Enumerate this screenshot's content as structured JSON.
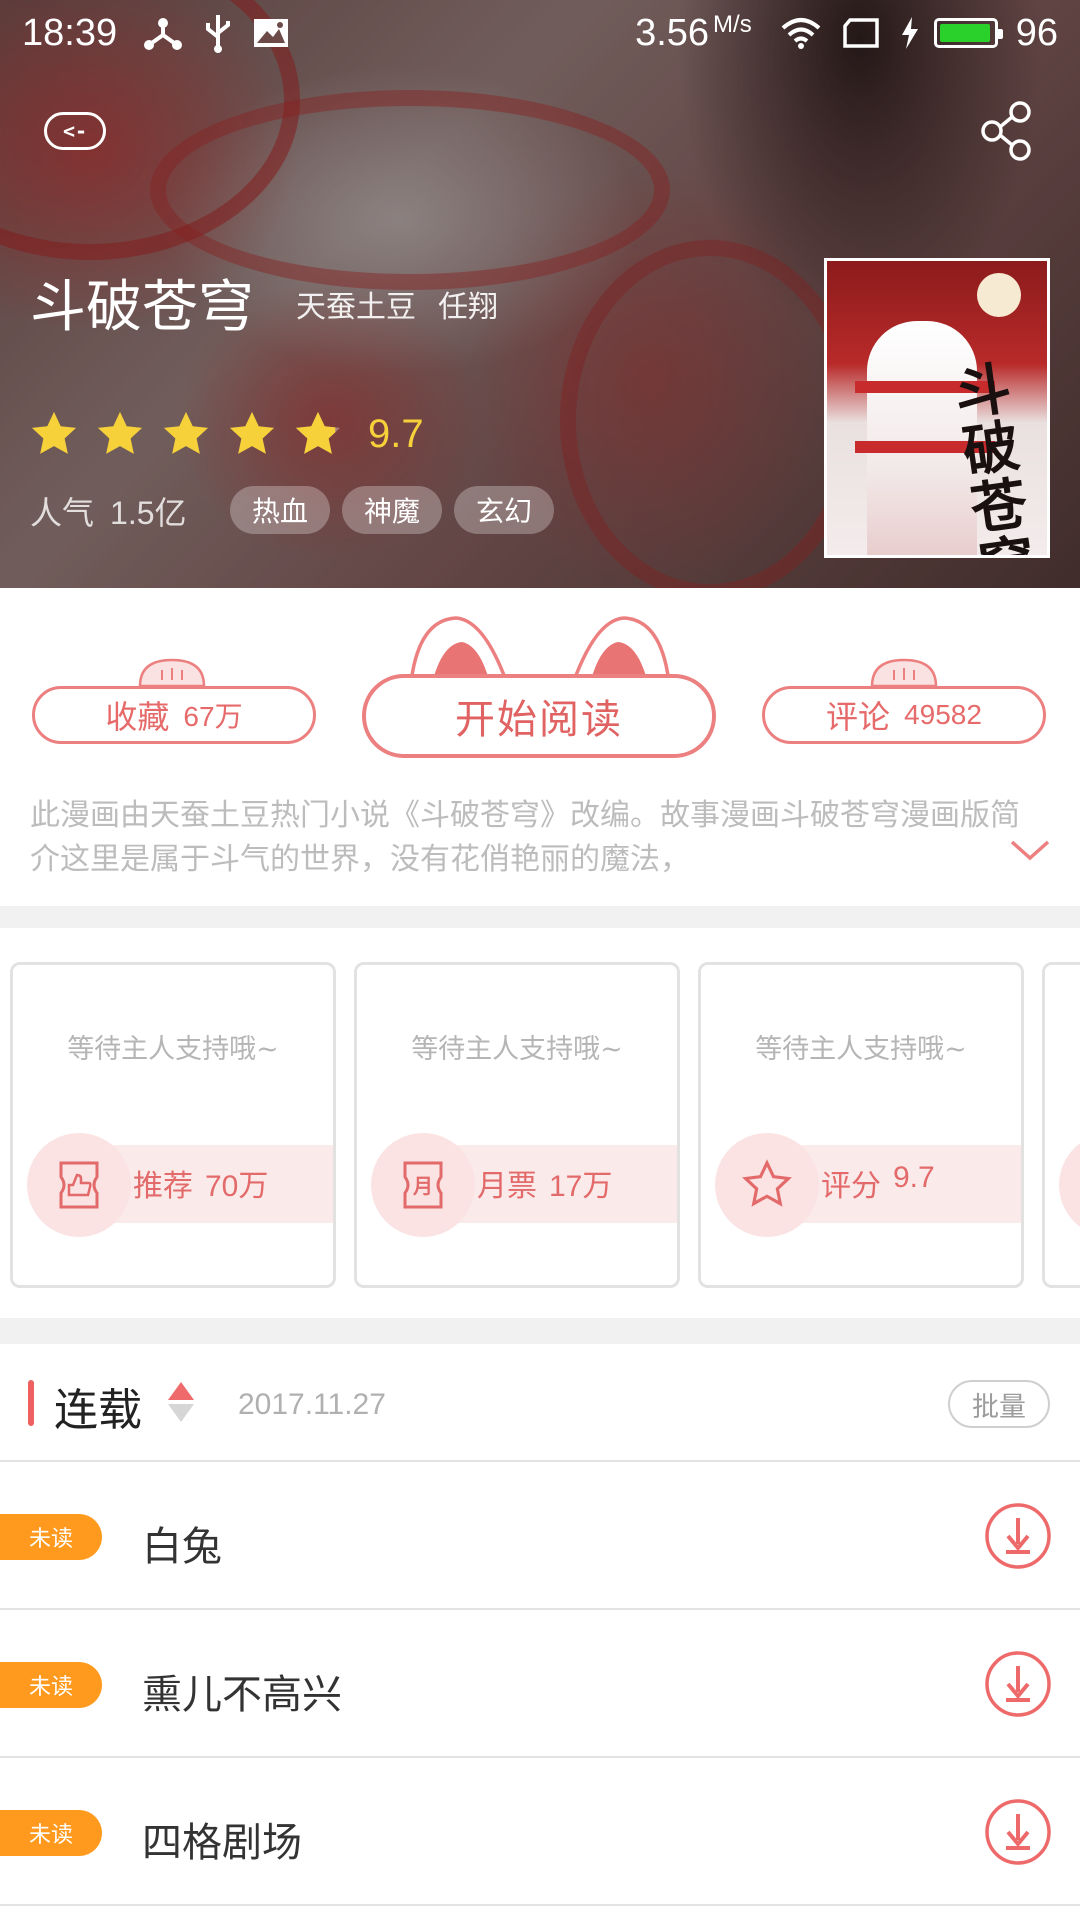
{
  "status_bar": {
    "time": "18:39",
    "net_speed": "3.56",
    "net_unit": "M/s",
    "battery_level": "96",
    "battery_fill": 0.96,
    "icons": [
      "share-network-icon",
      "usb-icon",
      "image-icon",
      "wifi-icon",
      "sim-icon",
      "charging-icon",
      "battery-icon"
    ]
  },
  "header": {
    "back_icon": "back-icon",
    "share_icon": "share-icon",
    "title": "斗破苍穹",
    "author_1": "天蚕土豆",
    "author_2": "任翔",
    "rating": 4.85,
    "rating_max": 5,
    "score": "9.7",
    "popularity_label": "人气",
    "popularity_value": "1.5亿",
    "tags": [
      "热血",
      "神魔",
      "玄幻"
    ],
    "cover_text": "斗破苍穹"
  },
  "actions": {
    "favorite_label": "收藏",
    "favorite_count": "67万",
    "read_label": "开始阅读",
    "comment_label": "评论",
    "comment_count": "49582",
    "description": "此漫画由天蚕土豆热门小说《斗破苍穹》改编。故事漫画斗破苍穹漫画版简介这里是属于斗气的世界，没有花俏艳丽的魔法，",
    "expand_icon": "chevron-down-icon"
  },
  "support_cards": [
    {
      "message": "等待主人支持哦~",
      "label": "推荐",
      "value": "70万",
      "icon": "thumbs-up-ticket-icon"
    },
    {
      "message": "等待主人支持哦~",
      "label": "月票",
      "value": "17万",
      "icon": "monthly-ticket-icon"
    },
    {
      "message": "等待主人支持哦~",
      "label": "评分",
      "value": "9.7",
      "icon": "star-outline-icon"
    }
  ],
  "chapters": {
    "section_label": "连载",
    "update_date": "2017.11.27",
    "batch_label": "批量",
    "items": [
      {
        "badge": "未读",
        "title": "白兔"
      },
      {
        "badge": "未读",
        "title": "熏儿不高兴"
      },
      {
        "badge": "未读",
        "title": "四格剧场"
      }
    ]
  },
  "colors": {
    "accent": "#ec7f7f",
    "star": "#f6d13a",
    "unread_badge": "#ff9a1f",
    "battery": "#2bd12b"
  }
}
